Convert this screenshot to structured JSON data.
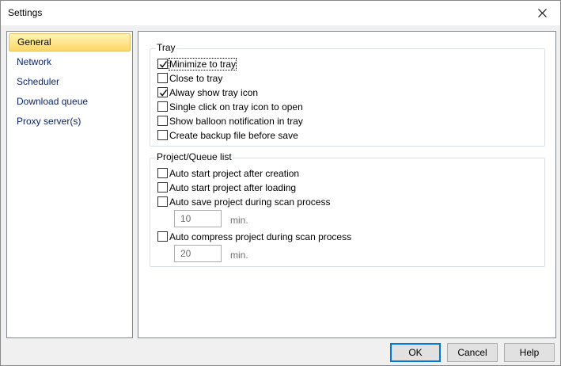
{
  "window": {
    "title": "Settings"
  },
  "sidebar": {
    "items": [
      {
        "label": "General"
      },
      {
        "label": "Network"
      },
      {
        "label": "Scheduler"
      },
      {
        "label": "Download queue"
      },
      {
        "label": "Proxy server(s)"
      }
    ]
  },
  "tray": {
    "title": "Tray",
    "options": [
      {
        "label": "Minimize to tray",
        "checked": true
      },
      {
        "label": "Close to tray",
        "checked": false
      },
      {
        "label": "Alway show tray icon",
        "checked": true
      },
      {
        "label": "Single click on tray icon to open",
        "checked": false
      },
      {
        "label": "Show balloon notification in tray",
        "checked": false
      },
      {
        "label": "Create backup file before save",
        "checked": false
      }
    ]
  },
  "project": {
    "title": "Project/Queue list",
    "auto_start_creation": {
      "label": "Auto start project after creation",
      "checked": false
    },
    "auto_start_loading": {
      "label": "Auto start project after loading",
      "checked": false
    },
    "auto_save": {
      "label": "Auto save project during scan process",
      "checked": false,
      "value": "10",
      "unit": "min."
    },
    "auto_compress": {
      "label": "Auto compress project during scan process",
      "checked": false,
      "value": "20",
      "unit": "min."
    }
  },
  "buttons": {
    "ok": "OK",
    "cancel": "Cancel",
    "help": "Help"
  }
}
